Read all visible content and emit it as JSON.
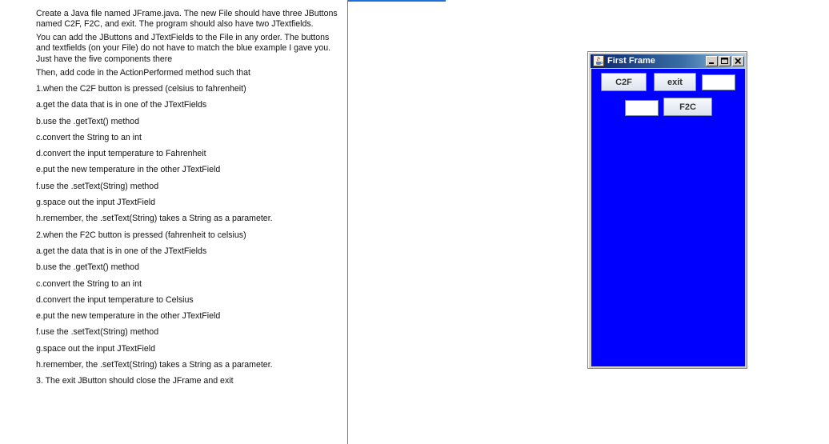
{
  "instructions": {
    "paragraphs": [
      "Create a Java file named JFrame.java. The new File should have three JButtons named C2F, F2C, and exit. The program should also have two JTextfields.",
      "You can add the JButtons and JTextFields to the File in any order. The buttons and textfields (on your File) do not have to match the blue example I gave you. Just have the five components there",
      "Then, add code in the ActionPerformed method such that"
    ],
    "lines": [
      "1.when the C2F button is pressed (celsius to fahrenheit)",
      "a.get the data that is in one of the JTextFields",
      "b.use the .getText() method",
      "c.convert the String to an int",
      "d.convert the input temperature to Fahrenheit",
      "e.put the new temperature in the other JTextField",
      "f.use the .setText(String) method",
      "g.space out the input JTextField",
      "h.remember, the .setText(String) takes a String as a parameter.",
      "2.when the F2C button is pressed (fahrenheit to celsius)",
      "a.get the data that is in one of the JTextFields",
      "b.use the .getText() method",
      "c.convert the String to an int",
      "d.convert the input temperature to Celsius",
      "e.put the new temperature in the other JTextField",
      "f.use the .setText(String) method",
      "g.space out the input JTextField",
      "h.remember, the .setText(String) takes a String as a parameter.",
      "3. The exit JButton should close the JFrame and exit"
    ]
  },
  "frame": {
    "title": "First Frame",
    "content_color": "#0000ff",
    "buttons": {
      "c2f": "C2F",
      "exit": "exit",
      "f2c": "F2C"
    },
    "fields": {
      "field_top": "",
      "field_bottom": ""
    }
  },
  "icons": {
    "app": "java-coffee-icon",
    "minimize": "minimize-icon",
    "maximize": "maximize-icon",
    "close": "close-icon"
  }
}
